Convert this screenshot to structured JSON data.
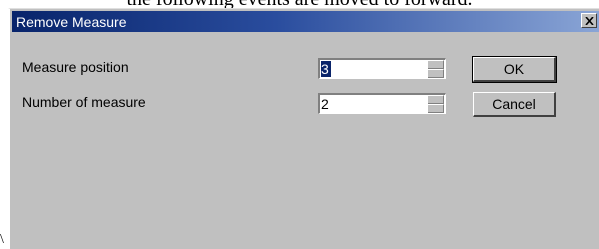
{
  "background": {
    "top_text": "the following events are moved to forward.",
    "stray_glyph": "\\"
  },
  "dialog": {
    "title": "Remove Measure",
    "close_symbol": "×",
    "fields": [
      {
        "label": "Measure position",
        "value": "3"
      },
      {
        "label": "Number of measure",
        "value": "2"
      }
    ],
    "buttons": {
      "ok": "OK",
      "cancel": "Cancel"
    }
  },
  "colors": {
    "titlebar_start": "#08246b",
    "titlebar_end": "#8aa5d6",
    "face": "#c0c0c0",
    "selection": "#0a246a"
  }
}
